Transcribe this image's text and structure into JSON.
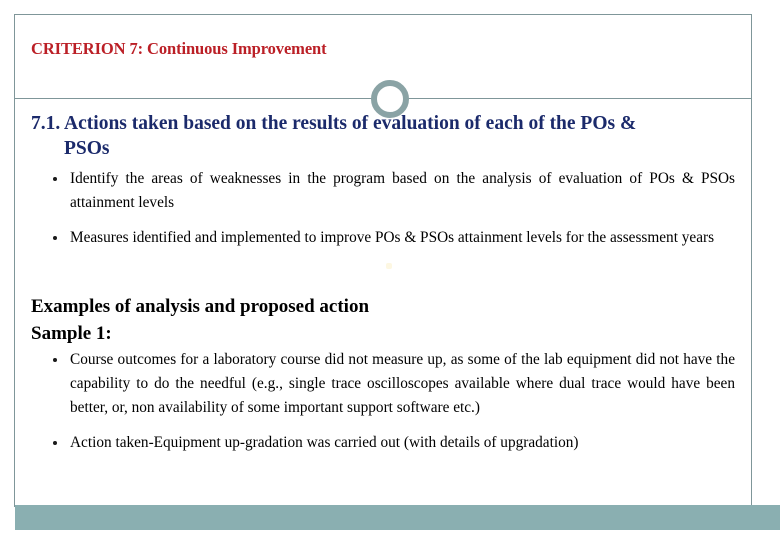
{
  "slide": {
    "header": {
      "criterion_title": "CRITERION 7: Continuous Improvement",
      "ornament": "ring-circle"
    },
    "section": {
      "heading_line1": "7.1. Actions taken based on the results of evaluation of each of the POs &",
      "heading_line2": "PSOs"
    },
    "bullets_primary": [
      "Identify the areas of weaknesses in the program based on the analysis of evaluation of POs & PSOs attainment levels",
      "Measures identified and implemented to improve POs & PSOs attainment levels for the assessment years"
    ],
    "examples": {
      "title": "Examples of analysis and proposed action",
      "sample_label": "Sample 1:"
    },
    "bullets_sample": [
      "Course outcomes for a laboratory course did not measure up, as some of the lab equipment did not have the capability to do the needful (e.g., single trace oscilloscopes available where dual trace would have been better, or, non availability of some important support software etc.)",
      "Action taken-Equipment up-gradation was carried out (with details of upgradation)"
    ],
    "colors": {
      "criterion_red": "#bb1f26",
      "heading_navy": "#1b2a6b",
      "frame_line": "#7f9699",
      "ornament": "#8aa3a5",
      "bottom_bar": "#8aafb1",
      "body_text": "#000000"
    }
  }
}
